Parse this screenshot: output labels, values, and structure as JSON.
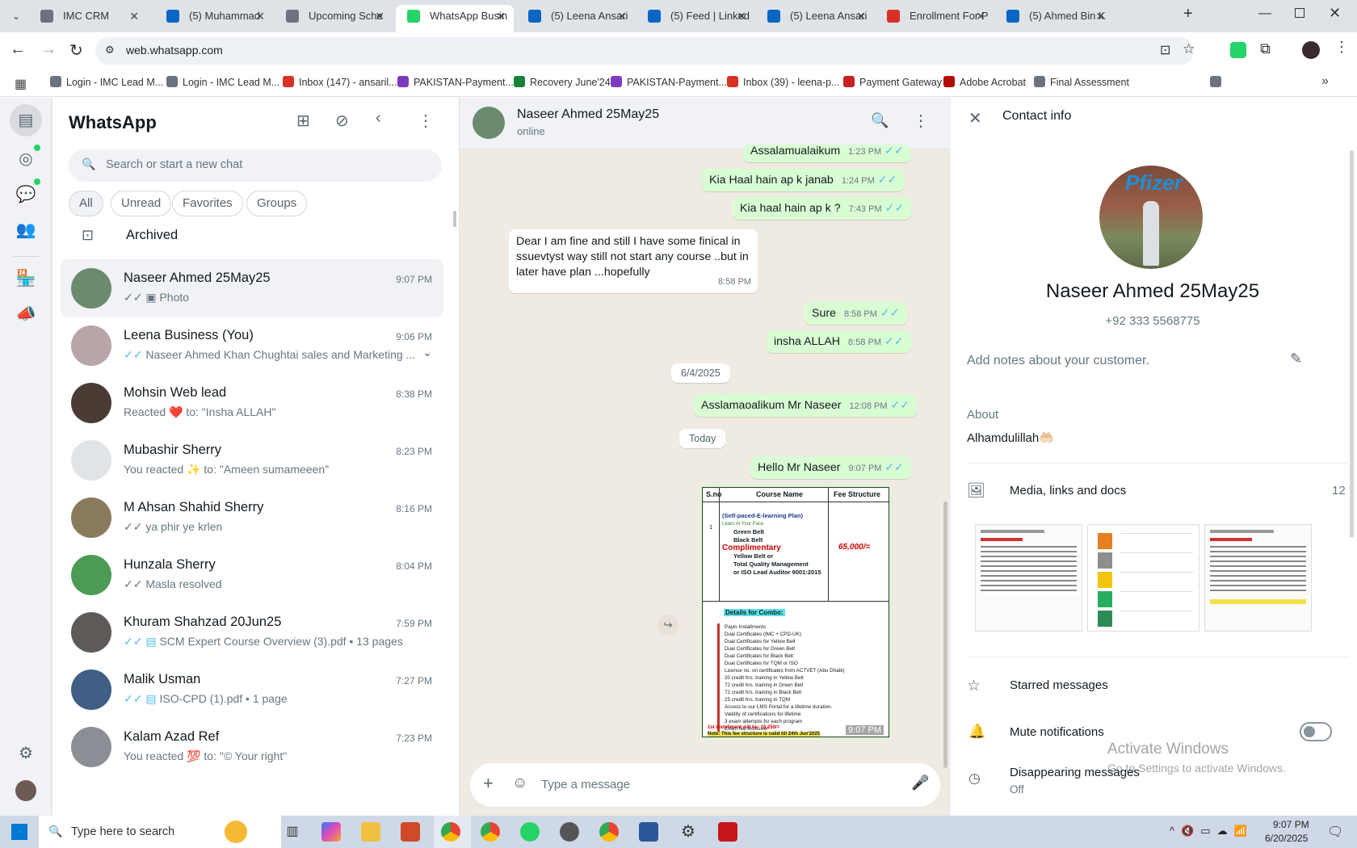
{
  "browser": {
    "tabs": [
      {
        "label": "IMC CRM",
        "color": "#6b7280"
      },
      {
        "label": "(5) Muhammad",
        "color": "#0a66c2"
      },
      {
        "label": "Upcoming Sche",
        "color": "#6b7280"
      },
      {
        "label": "WhatsApp Busin",
        "color": "#25d366"
      },
      {
        "label": "(5) Leena Ansari",
        "color": "#0a66c2"
      },
      {
        "label": "(5) Feed | Linked",
        "color": "#0a66c2"
      },
      {
        "label": "(5) Leena Ansari",
        "color": "#0a66c2"
      },
      {
        "label": "Enrollment For P",
        "color": "#d93025"
      },
      {
        "label": "(5) Ahmed Bin K",
        "color": "#0a66c2"
      }
    ],
    "url": "web.whatsapp.com",
    "bookmarks": [
      {
        "label": "Login - IMC Lead M...",
        "color": "#6b7280"
      },
      {
        "label": "Login - IMC Lead M...",
        "color": "#6b7280"
      },
      {
        "label": "Inbox (147) - ansaril...",
        "color": "#d93025"
      },
      {
        "label": "PAKISTAN-Payment...",
        "color": "#7e3bbf"
      },
      {
        "label": "Recovery June'24",
        "color": "#188038"
      },
      {
        "label": "PAKISTAN-Payment...",
        "color": "#7e3bbf"
      },
      {
        "label": "Inbox (39) - leena-p...",
        "color": "#d93025"
      },
      {
        "label": "Payment Gateway",
        "color": "#c5221f"
      },
      {
        "label": "Adobe Acrobat",
        "color": "#b30b00"
      },
      {
        "label": "Final Assessment",
        "color": "#6b7280"
      }
    ]
  },
  "sidebar": {
    "title": "WhatsApp",
    "search_placeholder": "Search or start a new chat",
    "filters": [
      "All",
      "Unread",
      "Favorites",
      "Groups"
    ],
    "archived_label": "Archived",
    "chats": [
      {
        "name": "Naseer Ahmed 25May25",
        "time": "9:07 PM",
        "preview": "Photo",
        "avatar": "#6b8a6f"
      },
      {
        "name": "Leena Business (You)",
        "time": "9:06 PM",
        "preview": "Naseer Ahmed Khan Chughtai sales and Marketing ...",
        "avatar": "#b9a5a8"
      },
      {
        "name": "Mohsin Web lead",
        "time": "8:38 PM",
        "preview": "Reacted ❤️ to: \"Insha ALLAH\"",
        "avatar": "#4a3b35"
      },
      {
        "name": "Mubashir Sherry",
        "time": "8:23 PM",
        "preview": "You reacted ✨ to: \"Ameen sumameeen\"",
        "avatar": "#dfe5e7"
      },
      {
        "name": "M Ahsan Shahid Sherry",
        "time": "8:16 PM",
        "preview": "ya phir ye krlen",
        "avatar": "#8a7a5c"
      },
      {
        "name": "Hunzala Sherry",
        "time": "8:04 PM",
        "preview": "Masla resolved",
        "avatar": "#4d9a55"
      },
      {
        "name": "Khuram Shahzad 20Jun25",
        "time": "7:59 PM",
        "preview": "SCM Expert Course Overview (3).pdf • 13 pages",
        "avatar": "#5f5a57"
      },
      {
        "name": "Malik Usman",
        "time": "7:27 PM",
        "preview": "ISO-CPD (1).pdf • 1 page",
        "avatar": "#3f5f84"
      },
      {
        "name": "Kalam Azad Ref",
        "time": "7:23 PM",
        "preview": "You reacted 💯 to: \"© Your right\"",
        "avatar": "#8a8f96"
      }
    ]
  },
  "conversation": {
    "contact_name": "Naseer Ahmed 25May25",
    "status": "online",
    "messages": [
      {
        "text": "Assalamualaikum",
        "time": "1:23 PM"
      },
      {
        "text": "Kia Haal hain ap k janab",
        "time": "1:24 PM"
      },
      {
        "text": "Kia haal hain ap k ?",
        "time": "7:43 PM"
      },
      {
        "text": "Dear I am fine and still I  have some finical in ssuevtyst way still not start any course ..but in later have plan ...hopefully",
        "time": "8:58 PM"
      },
      {
        "text": "Sure",
        "time": "8:58 PM"
      },
      {
        "text": "insha ALLAH",
        "time": "8:58 PM"
      },
      {
        "text": "Asslamaoalikum Mr Naseer",
        "time": "12:08 PM"
      },
      {
        "text": "Hello Mr Naseer",
        "time": "9:07 PM"
      }
    ],
    "date_separators": [
      "6/4/2025",
      "Today"
    ],
    "image_message": {
      "time": "9:07 PM",
      "col_headers": [
        "S.no",
        "Course Name",
        "Fee Structure"
      ],
      "sno": "1",
      "plan": "(Self-paced-E-learning Plan)",
      "learn": "Learn At Your Pace",
      "belts": [
        "Green Belt",
        "Black Belt"
      ],
      "complimentary": "Complimentary",
      "comp_items": [
        "Yellow Belt or",
        "Total Quality Management",
        "or ISO Lead Auditor 9001:2015"
      ],
      "fee": "65,000/=",
      "combo_title": "Details for Combo:",
      "combo_items": [
        "Payin Installments",
        "Dual Certificates (IMC + CPD-UK)",
        "Dual Certificates for Yellow Belt",
        "Dual Certificates for Green Belt",
        "Dual Certificates for Black Belt",
        "Dual Certificates for TQM or ISO",
        "License no. on certificates from ACTVET (Abu Dhabi)",
        "20 credit hrs. training in Yellow Belt",
        "72 credit hrs. training in Green Belt",
        "72 credit hrs. training in Black Belt",
        "25 credit hrs. training in TQM",
        "Access to our LMS Portal for a lifetime duration.",
        "Validity of certifications for lifetime",
        "3 exam attempts for each program",
        "Exam fee inclusive*"
      ],
      "footer1": "1st Installment will be: 16,250/=",
      "footer2": "Note: This fee structure is valid till 24th Jun'2025"
    },
    "composer_placeholder": "Type a message"
  },
  "contact_info": {
    "title": "Contact info",
    "name": "Naseer Ahmed 25May25",
    "phone": "+92 333 5568775",
    "notes_placeholder": "Add notes about your customer.",
    "about_label": "About",
    "about_text": "Alhamdulillah🤲🏻",
    "media_label": "Media, links and docs",
    "media_count": "12",
    "starred_label": "Starred messages",
    "mute_label": "Mute notifications",
    "disappearing_label": "Disappearing messages",
    "disappearing_value": "Off",
    "avatar_text": "Pfizer"
  },
  "watermark": {
    "line1": "Activate Windows",
    "line2": "Go to Settings to activate Windows."
  },
  "taskbar": {
    "search_placeholder": "Type here to search",
    "time": "9:07 PM",
    "date": "6/20/2025"
  }
}
